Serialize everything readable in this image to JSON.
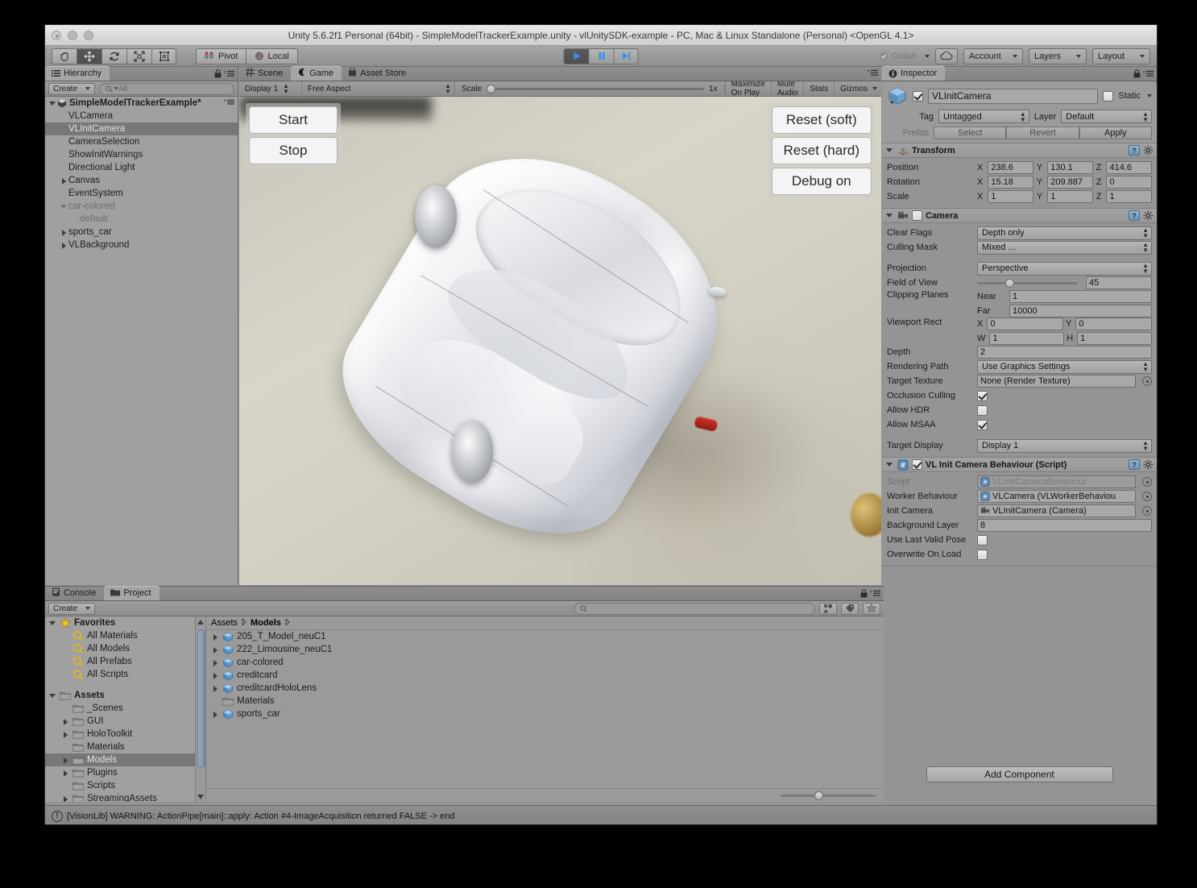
{
  "window": {
    "title": "Unity 5.6.2f1 Personal (64bit) - SimpleModelTrackerExample.unity - vlUnitySDK-example - PC, Mac & Linux Standalone (Personal) <OpenGL 4.1>"
  },
  "toolbar": {
    "tools": [
      "hand-tool",
      "move-tool",
      "rotate-tool",
      "scale-tool",
      "rect-tool"
    ],
    "active_tool_index": 1,
    "pivot_label": "Pivot",
    "local_label": "Local",
    "play_label": "play",
    "pause_label": "pause",
    "step_label": "step",
    "playing": true,
    "collab_label": "Collab",
    "cloud_label": "cloud",
    "account_label": "Account",
    "layers_label": "Layers",
    "layout_label": "Layout"
  },
  "hierarchy": {
    "tab_label": "Hierarchy",
    "create_label": "Create",
    "search_placeholder": "All",
    "items": [
      {
        "label": "SimpleModelTrackerExample*",
        "depth": 0,
        "arrow": "down",
        "root": true,
        "selected": false,
        "dim": false
      },
      {
        "label": "VLCamera",
        "depth": 1,
        "arrow": "none",
        "root": false,
        "selected": false,
        "dim": false
      },
      {
        "label": "VLInitCamera",
        "depth": 1,
        "arrow": "none",
        "root": false,
        "selected": true,
        "dim": false
      },
      {
        "label": "CameraSelection",
        "depth": 1,
        "arrow": "none",
        "root": false,
        "selected": false,
        "dim": false
      },
      {
        "label": "ShowInitWarnings",
        "depth": 1,
        "arrow": "none",
        "root": false,
        "selected": false,
        "dim": false
      },
      {
        "label": "Directional Light",
        "depth": 1,
        "arrow": "none",
        "root": false,
        "selected": false,
        "dim": false
      },
      {
        "label": "Canvas",
        "depth": 1,
        "arrow": "right",
        "root": false,
        "selected": false,
        "dim": false
      },
      {
        "label": "EventSystem",
        "depth": 1,
        "arrow": "none",
        "root": false,
        "selected": false,
        "dim": false
      },
      {
        "label": "car-colored",
        "depth": 1,
        "arrow": "down",
        "root": false,
        "selected": false,
        "dim": true
      },
      {
        "label": "default",
        "depth": 2,
        "arrow": "none",
        "root": false,
        "selected": false,
        "dim": true
      },
      {
        "label": "sports_car",
        "depth": 1,
        "arrow": "right",
        "root": false,
        "selected": false,
        "dim": false
      },
      {
        "label": "VLBackground",
        "depth": 1,
        "arrow": "right",
        "root": false,
        "selected": false,
        "dim": false
      }
    ]
  },
  "center_tabs": [
    {
      "label": "Scene",
      "icon": "grid-icon",
      "active": false
    },
    {
      "label": "Game",
      "icon": "gamepad-icon",
      "active": true
    },
    {
      "label": "Asset Store",
      "icon": "store-icon",
      "active": false
    }
  ],
  "game_toolbar": {
    "display": "Display 1",
    "aspect": "Free Aspect",
    "scale_label": "Scale",
    "scale_value": "1x",
    "maximize_label": "Maximize On Play",
    "mute_label": "Mute Audio",
    "stats_label": "Stats",
    "gizmos_label": "Gizmos"
  },
  "game_ui": {
    "left_buttons": [
      "Start",
      "Stop"
    ],
    "right_buttons": [
      "Reset (soft)",
      "Reset (hard)",
      "Debug on"
    ]
  },
  "inspector": {
    "tab_label": "Inspector",
    "object_name": "VLInitCamera",
    "object_enabled": true,
    "static_label": "Static",
    "static_checked": false,
    "tag_label": "Tag",
    "tag_value": "Untagged",
    "layer_label": "Layer",
    "layer_value": "Default",
    "prefab_label": "Prefab",
    "select_label": "Select",
    "revert_label": "Revert",
    "apply_label": "Apply",
    "add_component_label": "Add Component",
    "components": [
      {
        "title": "Transform",
        "icon": "transform-icon",
        "has_checkbox": false,
        "rows": [
          {
            "type": "vec3",
            "label": "Position",
            "x": "238.6",
            "y": "130.1",
            "z": "414.6"
          },
          {
            "type": "vec3",
            "label": "Rotation",
            "x": "15.18",
            "y": "209.887",
            "z": "0"
          },
          {
            "type": "vec3",
            "label": "Scale",
            "x": "1",
            "y": "1",
            "z": "1"
          }
        ]
      },
      {
        "title": "Camera",
        "icon": "camera-icon",
        "has_checkbox": true,
        "checked": false,
        "rows": [
          {
            "type": "popup",
            "label": "Clear Flags",
            "value": "Depth only"
          },
          {
            "type": "popup",
            "label": "Culling Mask",
            "value": "Mixed ..."
          },
          {
            "type": "spacer"
          },
          {
            "type": "popup",
            "label": "Projection",
            "value": "Perspective"
          },
          {
            "type": "slider",
            "label": "Field of View",
            "value": "45",
            "percent": 28
          },
          {
            "type": "pair2",
            "label": "Clipping Planes",
            "k1": "Near",
            "v1": "1",
            "k2": "Far",
            "v2": "10000"
          },
          {
            "type": "rect",
            "label": "Viewport Rect",
            "x": "0",
            "y": "0",
            "w": "1",
            "h": "1"
          },
          {
            "type": "text",
            "label": "Depth",
            "value": "2"
          },
          {
            "type": "popup",
            "label": "Rendering Path",
            "value": "Use Graphics Settings"
          },
          {
            "type": "objref",
            "label": "Target Texture",
            "value": "None (Render Texture)",
            "icon": ""
          },
          {
            "type": "check",
            "label": "Occlusion Culling",
            "checked": true
          },
          {
            "type": "check",
            "label": "Allow HDR",
            "checked": false
          },
          {
            "type": "check",
            "label": "Allow MSAA",
            "checked": true
          },
          {
            "type": "spacer"
          },
          {
            "type": "popup",
            "label": "Target Display",
            "value": "Display 1"
          }
        ]
      },
      {
        "title": "VL Init Camera Behaviour (Script)",
        "icon": "script-icon",
        "has_checkbox": true,
        "checked": true,
        "rows": [
          {
            "type": "objref",
            "label": "Script",
            "value": "VLInitCameraBehaviour",
            "icon": "script-icon",
            "readonly": true
          },
          {
            "type": "objref",
            "label": "Worker Behaviour",
            "value": "VLCamera (VLWorkerBehaviou",
            "icon": "script-icon"
          },
          {
            "type": "objref",
            "label": "Init Camera",
            "value": "VLInitCamera (Camera)",
            "icon": "camera-icon"
          },
          {
            "type": "text",
            "label": "Background Layer",
            "value": "8"
          },
          {
            "type": "check",
            "label": "Use Last Valid Pose",
            "checked": false
          },
          {
            "type": "check",
            "label": "Overwrite On Load",
            "checked": false
          }
        ]
      }
    ]
  },
  "project": {
    "tabs": [
      {
        "label": "Console",
        "icon": "console-icon",
        "active": false
      },
      {
        "label": "Project",
        "icon": "folder-icon",
        "active": true
      }
    ],
    "create_label": "Create",
    "search_placeholder": "",
    "tree": [
      {
        "label": "Favorites",
        "depth": 0,
        "arrow": "down",
        "icon": "star-icon",
        "bold": true,
        "selected": false
      },
      {
        "label": "All Materials",
        "depth": 1,
        "arrow": "none",
        "icon": "search-icon",
        "bold": false,
        "selected": false
      },
      {
        "label": "All Models",
        "depth": 1,
        "arrow": "none",
        "icon": "search-icon",
        "bold": false,
        "selected": false
      },
      {
        "label": "All Prefabs",
        "depth": 1,
        "arrow": "none",
        "icon": "search-icon",
        "bold": false,
        "selected": false
      },
      {
        "label": "All Scripts",
        "depth": 1,
        "arrow": "none",
        "icon": "search-icon",
        "bold": false,
        "selected": false
      },
      {
        "label": "",
        "depth": 0,
        "arrow": "none",
        "icon": "",
        "bold": false,
        "selected": false
      },
      {
        "label": "Assets",
        "depth": 0,
        "arrow": "down",
        "icon": "folder-icon",
        "bold": true,
        "selected": false
      },
      {
        "label": "_Scenes",
        "depth": 1,
        "arrow": "none",
        "icon": "folder-icon",
        "bold": false,
        "selected": false
      },
      {
        "label": "GUI",
        "depth": 1,
        "arrow": "right",
        "icon": "folder-icon",
        "bold": false,
        "selected": false
      },
      {
        "label": "HoloToolkit",
        "depth": 1,
        "arrow": "right",
        "icon": "folder-icon",
        "bold": false,
        "selected": false
      },
      {
        "label": "Materials",
        "depth": 1,
        "arrow": "none",
        "icon": "folder-icon",
        "bold": false,
        "selected": false
      },
      {
        "label": "Models",
        "depth": 1,
        "arrow": "right",
        "icon": "folder-icon",
        "bold": false,
        "selected": true
      },
      {
        "label": "Plugins",
        "depth": 1,
        "arrow": "right",
        "icon": "folder-icon",
        "bold": false,
        "selected": false
      },
      {
        "label": "Scripts",
        "depth": 1,
        "arrow": "none",
        "icon": "folder-icon",
        "bold": false,
        "selected": false
      },
      {
        "label": "StreamingAssets",
        "depth": 1,
        "arrow": "right",
        "icon": "folder-icon",
        "bold": false,
        "selected": false
      }
    ],
    "breadcrumb": [
      "Assets",
      "Models"
    ],
    "contents": [
      {
        "label": "205_T_Model_neuC1",
        "arrow": "right",
        "icon": "prefab-icon"
      },
      {
        "label": "222_Limousine_neuC1",
        "arrow": "right",
        "icon": "prefab-icon"
      },
      {
        "label": "car-colored",
        "arrow": "right",
        "icon": "prefab-icon"
      },
      {
        "label": "creditcard",
        "arrow": "right",
        "icon": "prefab-icon"
      },
      {
        "label": "creditcardHoloLens",
        "arrow": "right",
        "icon": "prefab-icon"
      },
      {
        "label": "Materials",
        "arrow": "none",
        "icon": "folder-icon"
      },
      {
        "label": "sports_car",
        "arrow": "right",
        "icon": "prefab-icon"
      }
    ]
  },
  "status": {
    "icon": "warning-icon",
    "message": "[VisionLib] WARNING: ActionPipe[main]::apply: Action #4-ImageAcquisition returned FALSE -> end"
  },
  "colors": {
    "panel_bg": "#949494",
    "panel_light": "#a0a0a0",
    "selection": "#787878",
    "play_active": "#2f7fe8",
    "accent_blue": "#3b7fd4"
  }
}
